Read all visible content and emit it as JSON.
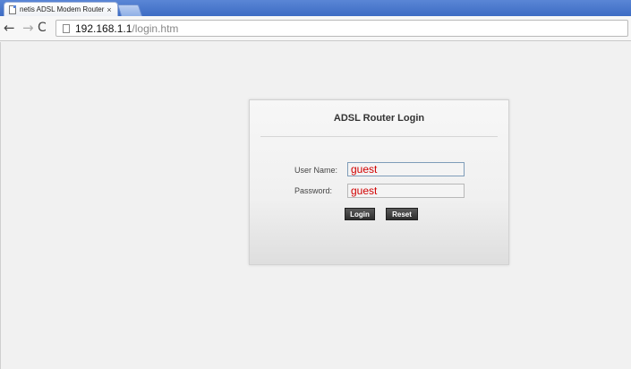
{
  "browser": {
    "tab_title": "netis ADSL Modem Router",
    "tab_close": "×",
    "back_glyph": "←",
    "forward_glyph": "→",
    "reload_glyph": "C",
    "url_host": "192.168.1.1",
    "url_path": "/login.htm",
    "icons": {
      "tab": "page-icon",
      "omnibox": "page-icon",
      "back": "back-arrow-icon",
      "forward": "forward-arrow-icon",
      "reload": "reload-icon"
    },
    "accent_color": "#4a78cf"
  },
  "login": {
    "title": "ADSL Router Login",
    "username_label": "User Name:",
    "username_value": "guest",
    "password_label": "Password:",
    "password_value": "guest",
    "login_button": "Login",
    "reset_button": "Reset",
    "input_text_color": "#d10000"
  }
}
